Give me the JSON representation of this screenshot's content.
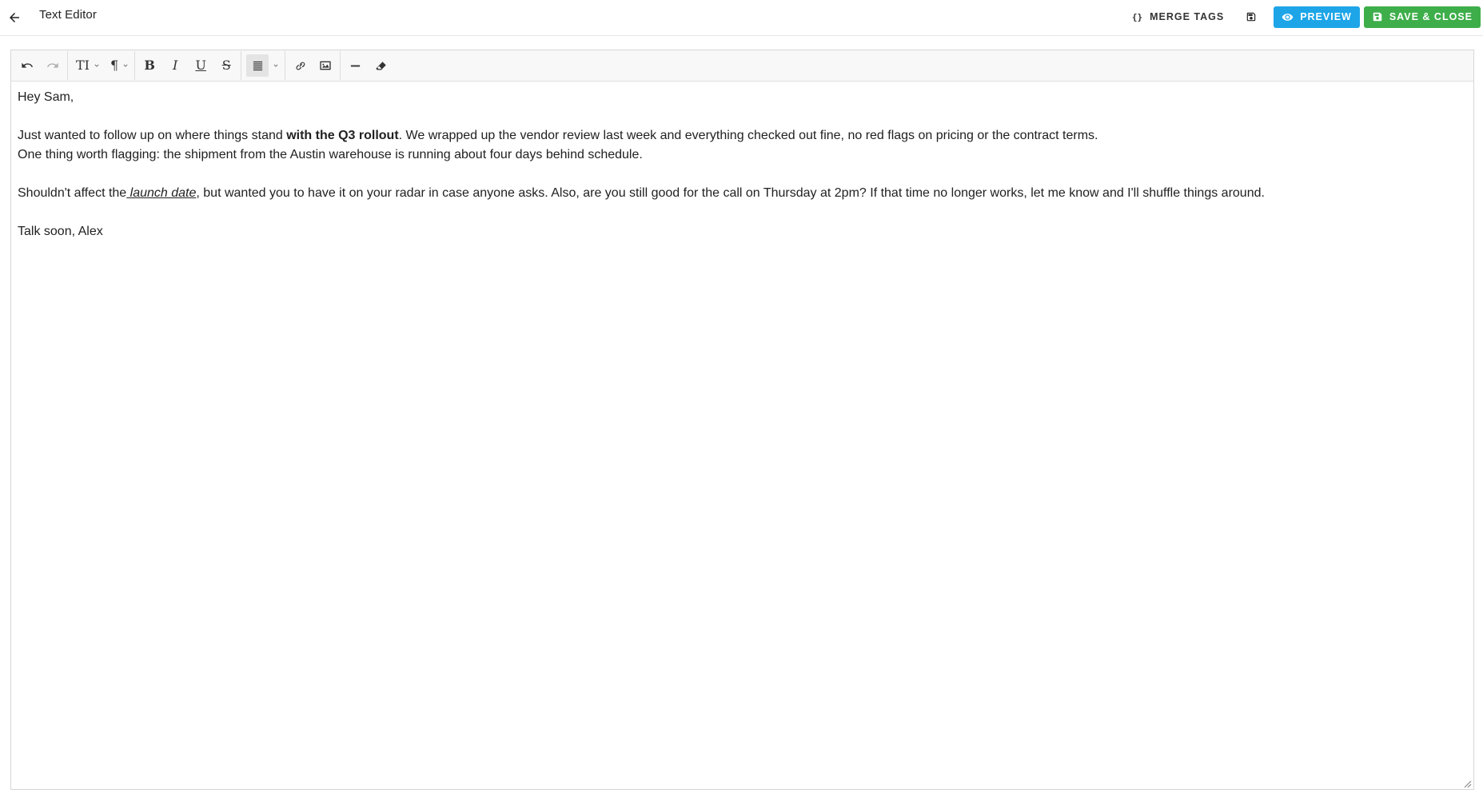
{
  "header": {
    "title": "Text Editor",
    "merge_tags_label": "MERGE TAGS",
    "merge_tags_glyph": "{}",
    "preview_label": "PREVIEW",
    "save_close_label": "SAVE & CLOSE"
  },
  "colors": {
    "preview_button": "#1da5e8",
    "save_close_button": "#3eae4a"
  },
  "toolbar": {
    "items": [
      {
        "name": "undo",
        "icon": "undo-icon"
      },
      {
        "name": "redo",
        "icon": "redo-icon",
        "disabled": true
      },
      {
        "name": "text-size",
        "icon": "text-size-icon",
        "glyph": "TI",
        "dropdown": true
      },
      {
        "name": "paragraph",
        "icon": "pilcrow-icon",
        "glyph": "¶",
        "dropdown": true
      },
      {
        "name": "bold",
        "icon": "bold-icon",
        "glyph": "B"
      },
      {
        "name": "italic",
        "icon": "italic-icon",
        "glyph": "I"
      },
      {
        "name": "underline",
        "icon": "underline-icon",
        "glyph": "U"
      },
      {
        "name": "strikethrough",
        "icon": "strikethrough-icon",
        "glyph": "S"
      },
      {
        "name": "align",
        "icon": "align-justify-icon",
        "dropdown": true,
        "active": true
      },
      {
        "name": "link",
        "icon": "link-icon"
      },
      {
        "name": "image",
        "icon": "image-icon"
      },
      {
        "name": "horizontal-rule",
        "icon": "horizontal-rule-icon"
      },
      {
        "name": "clear-format",
        "icon": "eraser-icon"
      }
    ]
  },
  "content": {
    "greeting": "Hey Sam,",
    "p1_a": "Just wanted to follow up on where things stand ",
    "p1_bold": "with the Q3 rollout",
    "p1_b": ". We wrapped up the vendor review last week and everything checked out fine, no red flags on pricing or the contract terms.",
    "p2": "One thing worth flagging: the shipment from the Austin warehouse is running about four days behind schedule.",
    "p3_a": "Shouldn't affect the",
    "p3_emph": " launch date",
    "p3_b": ", but wanted you to have it on your radar in case anyone asks. Also, are you still good for the call on Thursday at 2pm? If that time no longer works, let me know and I'll shuffle things around.",
    "closing": "Talk soon, Alex"
  }
}
